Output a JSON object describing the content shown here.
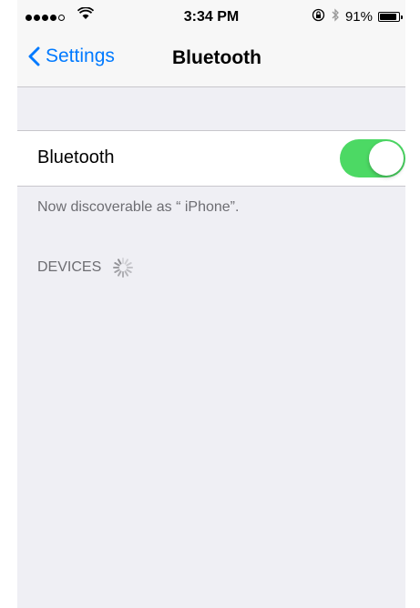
{
  "status_bar": {
    "time": "3:34 PM",
    "battery_percent": "91%",
    "battery_level": 0.91,
    "signal_bars_filled": 4,
    "signal_bars_total": 5
  },
  "nav": {
    "back_label": "Settings",
    "title": "Bluetooth"
  },
  "bluetooth_cell": {
    "label": "Bluetooth",
    "enabled": true
  },
  "discoverable_text": "Now discoverable as “ iPhone”.",
  "devices_header": "DEVICES",
  "colors": {
    "accent": "#007aff",
    "toggle_on": "#4cd964",
    "background": "#efeff4"
  }
}
